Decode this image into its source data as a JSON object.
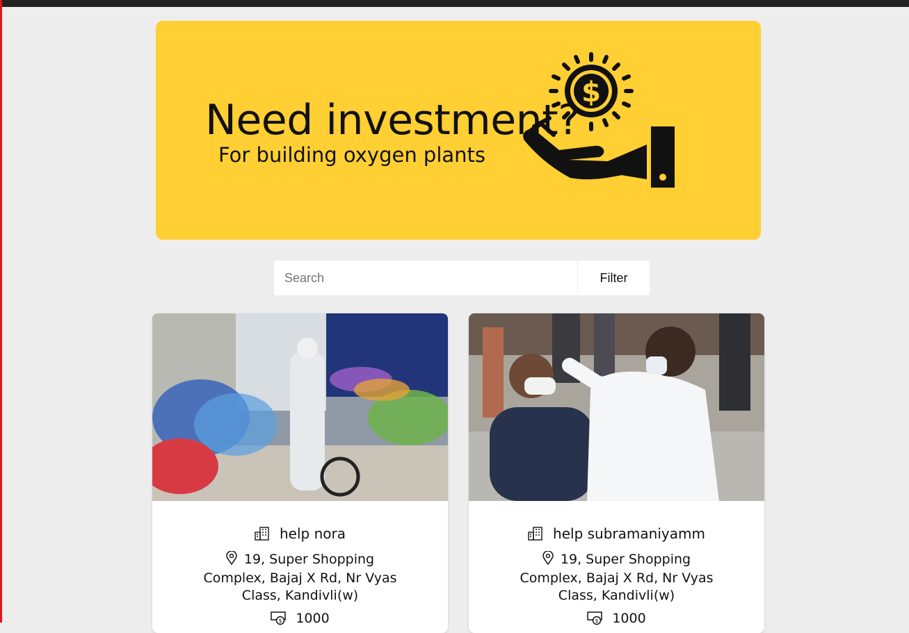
{
  "banner": {
    "title": "Need investment?",
    "subtitle": "For building oxygen plants",
    "art_icon": "hand-holding-dollar-coin-icon",
    "background_color": "#ffcf33"
  },
  "search": {
    "placeholder": "Search",
    "value": "",
    "filter_label": "Filter"
  },
  "cards": [
    {
      "image": "covid-ward-photo",
      "name_icon": "building-icon",
      "name": "help nora",
      "address_icon": "location-pin-icon",
      "address": "19, Super Shopping Complex, Bajaj X Rd, Nr Vyas Class, Kandivli(w)",
      "amount_icon": "money-icon",
      "amount": "1000"
    },
    {
      "image": "covid-testing-photo",
      "name_icon": "building-icon",
      "name": "help subramaniyamm",
      "address_icon": "location-pin-icon",
      "address": "19, Super Shopping Complex, Bajaj X Rd, Nr Vyas Class, Kandivli(w)",
      "amount_icon": "money-icon",
      "amount": "1000"
    }
  ]
}
